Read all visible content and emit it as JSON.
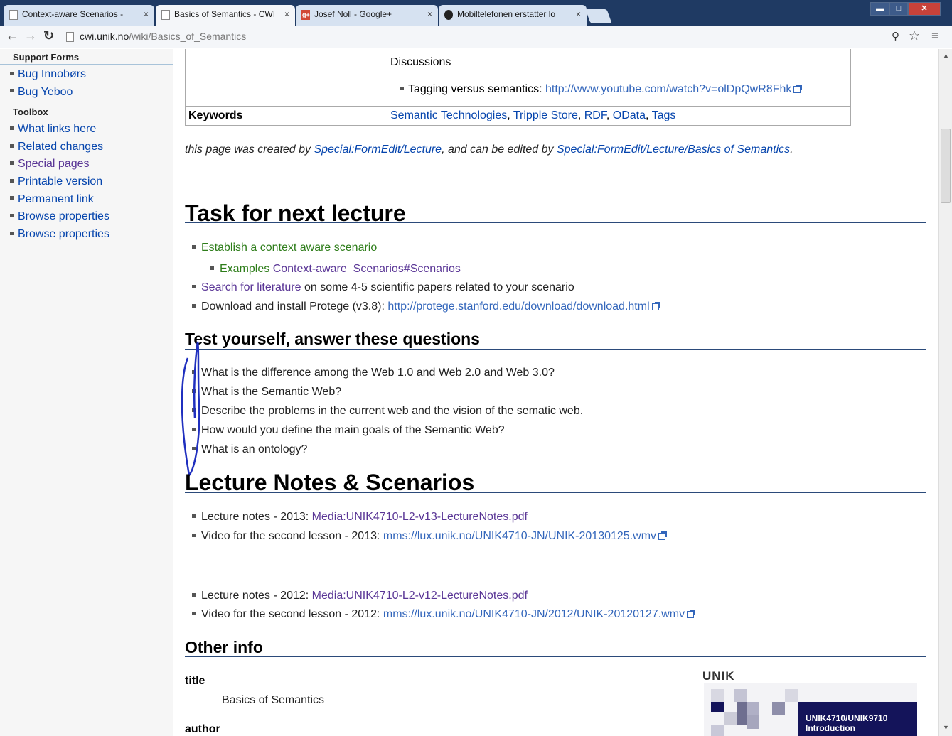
{
  "browser": {
    "tabs": [
      {
        "label": "Context-aware Scenarios -",
        "icon": "page-icon"
      },
      {
        "label": "Basics of Semantics - CWI",
        "icon": "page-icon"
      },
      {
        "label": "Josef Noll - Google+",
        "icon": "gplus-icon"
      },
      {
        "label": "Mobiltelefonen erstatter lo",
        "icon": "site-icon"
      }
    ],
    "close_glyph": "×",
    "url_domain": "cwi.unik.no",
    "url_path": "/wiki/Basics_of_Semantics"
  },
  "sidebar": {
    "sections": [
      {
        "heading": "Support Forms",
        "items": [
          "Bug Innobørs",
          "Bug Yeboo"
        ]
      },
      {
        "heading": "Toolbox",
        "items": [
          "What links here",
          "Related changes",
          "Special pages",
          "Printable version",
          "Permanent link",
          "Browse properties",
          "Browse properties"
        ]
      }
    ]
  },
  "table": {
    "discussions_label": "Discussions",
    "tagging_text": "Tagging versus semantics: ",
    "tagging_link": "http://www.youtube.com/watch?v=olDpQwR8Fhk",
    "keywords_label": "Keywords",
    "keywords": [
      "Semantic Technologies",
      "Tripple Store",
      "RDF",
      "OData",
      "Tags"
    ]
  },
  "credit": {
    "prefix": "this page was created by ",
    "link1": "Special:FormEdit/Lecture",
    "middle": ", and can be edited by ",
    "link2": "Special:FormEdit/Lecture/Basics of Semantics",
    "suffix": "."
  },
  "task": {
    "heading": "Task for next lecture",
    "item1": "Establish a context aware scenario",
    "item1_sub_a": "Examples",
    "item1_sub_b": "Context-aware_Scenarios#Scenarios",
    "item2_link": "Search for literature",
    "item2_text": " on some 4-5 scientific papers related to your scenario",
    "item3_text": "Download and install Protege (v3.8): ",
    "item3_link": "http://protege.stanford.edu/download/download.html"
  },
  "test": {
    "heading": "Test yourself, answer these questions",
    "questions": [
      "What is the difference among the Web 1.0 and Web 2.0 and Web 3.0?",
      "What is the Semantic Web?",
      "Describe the problems in the current web and the vision of the sematic web.",
      "How would you define the main goals of the Semantic Web?",
      "What is an ontology?"
    ]
  },
  "notes": {
    "heading": "Lecture Notes & Scenarios",
    "items": [
      {
        "text": "Lecture notes - 2013: ",
        "link": "Media:UNIK4710-L2-v13-LectureNotes.pdf"
      },
      {
        "text": "Video for the second lesson - 2013: ",
        "link": "mms://lux.unik.no/UNIK4710-JN/UNIK-20130125.wmv"
      },
      {
        "text": "Lecture notes - 2012: ",
        "link": "Media:UNIK4710-L2-v12-LectureNotes.pdf"
      },
      {
        "text": "Video for the second lesson - 2012: ",
        "link": "mms://lux.unik.no/UNIK4710-JN/2012/UNIK-20120127.wmv"
      }
    ]
  },
  "other": {
    "heading": "Other info",
    "title_label": "title",
    "title_value": "Basics of Semantics",
    "author_label": "author",
    "logo_text": "UNIK",
    "slide_title_line1": "UNIK4710/UNIK9710",
    "slide_title_line2": "Introduction"
  }
}
